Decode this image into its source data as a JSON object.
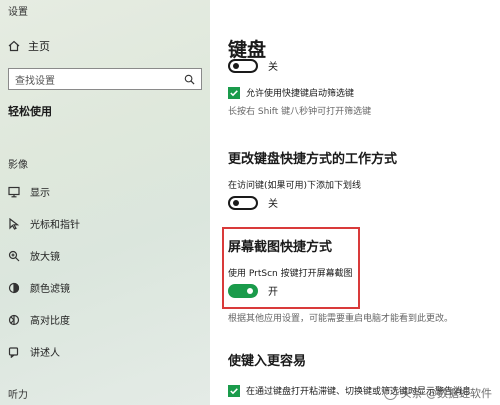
{
  "app": {
    "title": "设置"
  },
  "sidebar": {
    "home": "主页",
    "search_placeholder": "查找设置",
    "section": "轻松使用",
    "group_vision": "影像",
    "items": [
      {
        "label": "显示",
        "icon": "monitor-icon"
      },
      {
        "label": "光标和指针",
        "icon": "pointer-icon"
      },
      {
        "label": "放大镜",
        "icon": "magnifier-icon"
      },
      {
        "label": "颜色滤镜",
        "icon": "color-filter-icon"
      },
      {
        "label": "高对比度",
        "icon": "contrast-icon"
      },
      {
        "label": "讲述人",
        "icon": "narrator-icon"
      }
    ],
    "group_hearing": "听力"
  },
  "main": {
    "title": "键盘",
    "toggle1_state": "关",
    "check1_label": "允许使用快捷键启动筛选键",
    "check1_desc": "长按右 Shift 键八秒钟可打开筛选键",
    "section2_title": "更改键盘快捷方式的工作方式",
    "section2_desc": "在访问键(如果可用)下添加下划线",
    "toggle2_state": "关",
    "section3_title": "屏幕截图快捷方式",
    "section3_desc": "使用 PrtScn 按键打开屏幕截图",
    "toggle3_state": "开",
    "section3_note": "根据其他应用设置，可能需要重启电脑才能看到此更改。",
    "section4_title": "使键入更容易",
    "check2_label": "在通过键盘打开粘滞键、切换键或筛选键时显示警告消息"
  },
  "watermark": {
    "text": "头条 @数据蛙软件"
  },
  "colors": {
    "accent": "#1a9b4b",
    "highlight": "#d93a3a"
  }
}
